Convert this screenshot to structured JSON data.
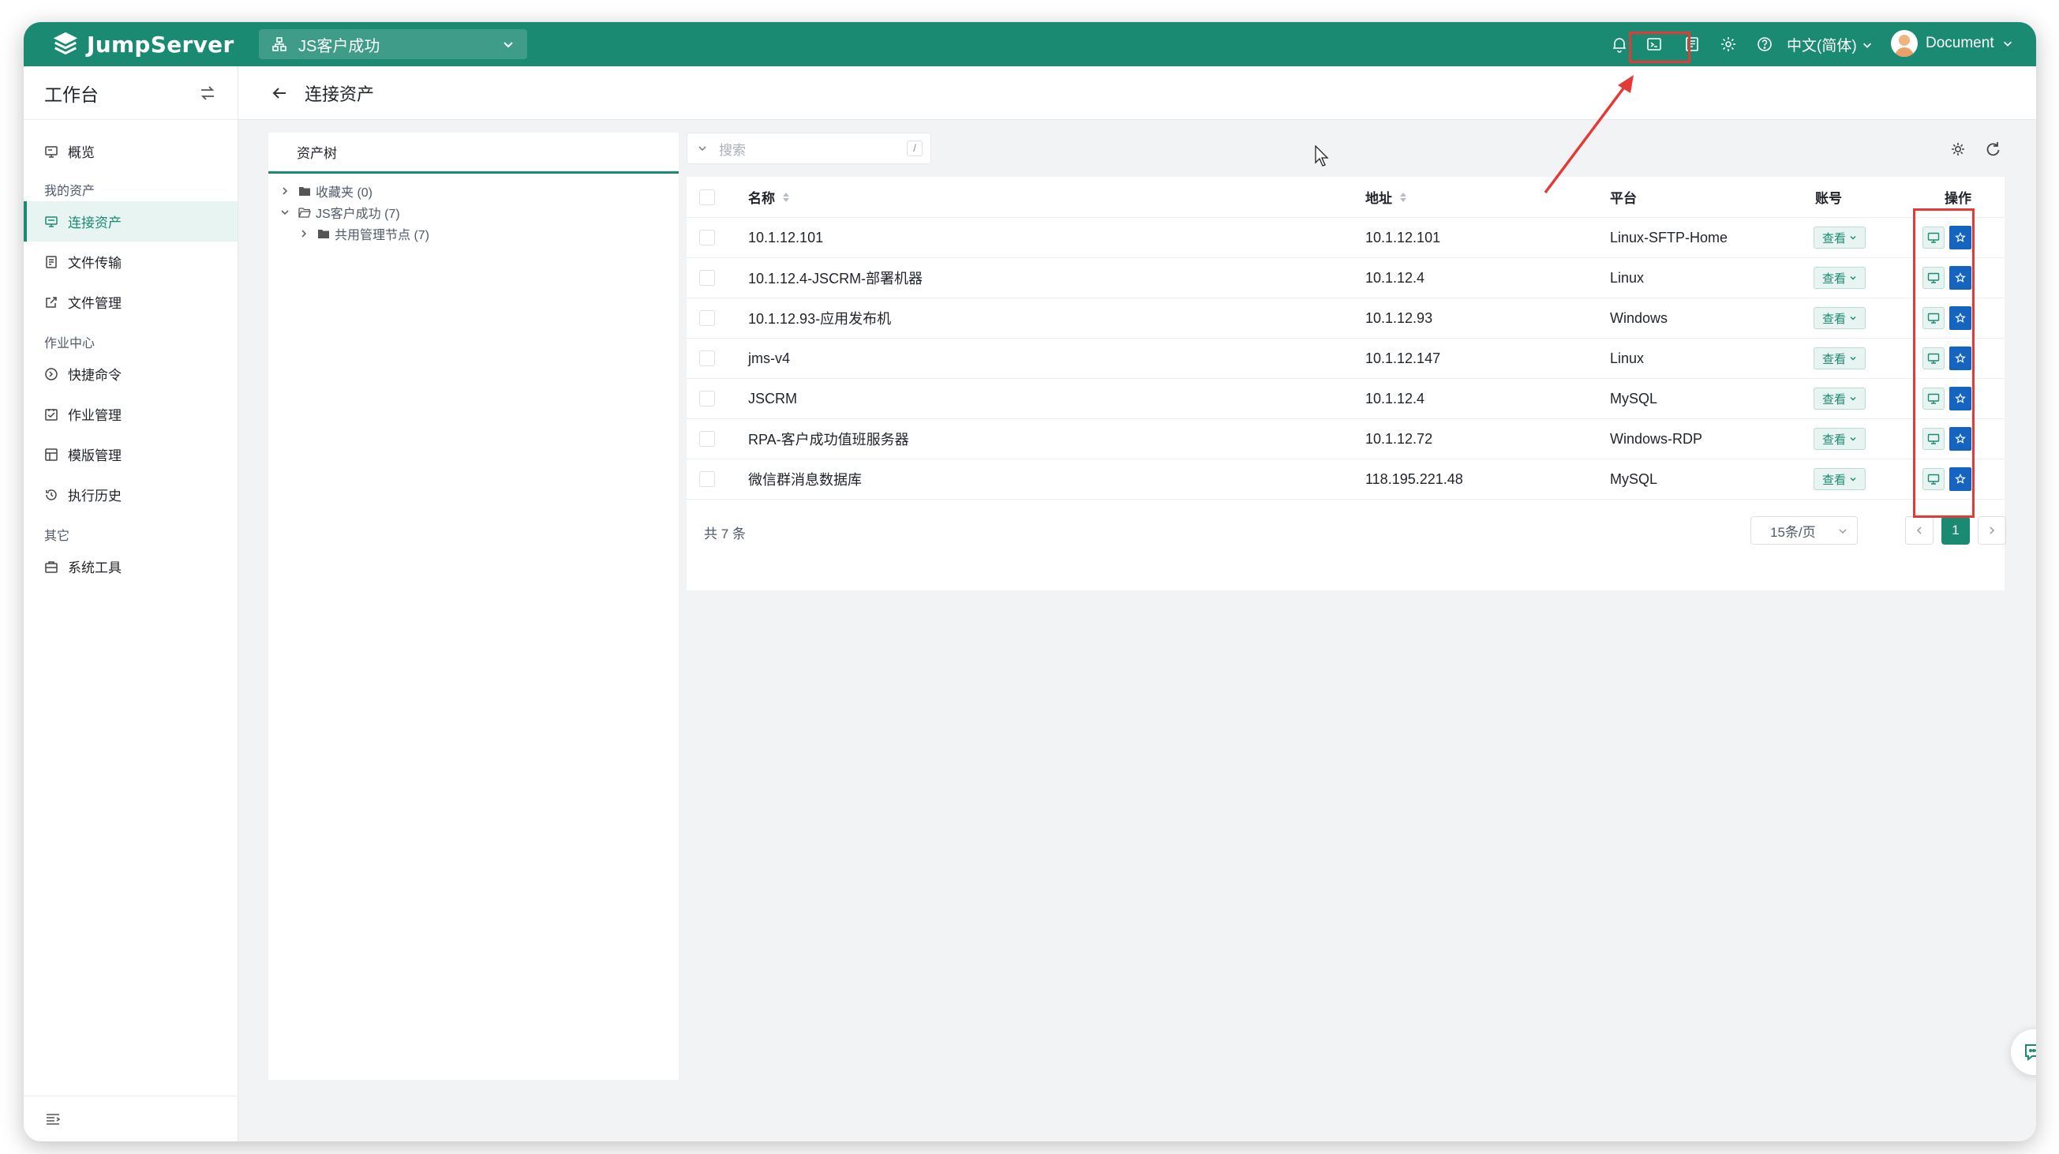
{
  "app": {
    "brand": "JumpServer",
    "org_select": "JS客户成功",
    "language": "中文(简体)",
    "user": "Document"
  },
  "sidebar": {
    "title": "工作台",
    "groups": [
      {
        "title": "",
        "items": [
          {
            "label": "概览",
            "icon": "monitor-icon"
          }
        ]
      },
      {
        "title": "我的资产",
        "items": [
          {
            "label": "连接资产",
            "icon": "desktop-icon",
            "active": true
          },
          {
            "label": "文件传输",
            "icon": "file-transfer-icon"
          },
          {
            "label": "文件管理",
            "icon": "external-link-icon"
          }
        ]
      },
      {
        "title": "作业中心",
        "items": [
          {
            "label": "快捷命令",
            "icon": "command-icon"
          },
          {
            "label": "作业管理",
            "icon": "job-icon"
          },
          {
            "label": "模版管理",
            "icon": "template-icon"
          },
          {
            "label": "执行历史",
            "icon": "history-icon"
          }
        ]
      },
      {
        "title": "其它",
        "items": [
          {
            "label": "系统工具",
            "icon": "toolbox-icon"
          }
        ]
      }
    ]
  },
  "page": {
    "title": "连接资产"
  },
  "tree": {
    "title": "资产树",
    "nodes": [
      {
        "label": "收藏夹 (0)",
        "level": 0,
        "expanded": false
      },
      {
        "label": "JS客户成功 (7)",
        "level": 0,
        "expanded": true
      },
      {
        "label": "共用管理节点 (7)",
        "level": 1,
        "expanded": false
      }
    ]
  },
  "search": {
    "placeholder": "搜索",
    "shortcut": "/"
  },
  "table": {
    "headers": {
      "name": "名称",
      "address": "地址",
      "platform": "平台",
      "account": "账号",
      "actions": "操作"
    },
    "view_label": "查看",
    "rows": [
      {
        "name": "10.1.12.101",
        "address": "10.1.12.101",
        "platform": "Linux-SFTP-Home"
      },
      {
        "name": "10.1.12.4-JSCRM-部署机器",
        "address": "10.1.12.4",
        "platform": "Linux"
      },
      {
        "name": "10.1.12.93-应用发布机",
        "address": "10.1.12.93",
        "platform": "Windows"
      },
      {
        "name": "jms-v4",
        "address": "10.1.12.147",
        "platform": "Linux"
      },
      {
        "name": "JSCRM",
        "address": "10.1.12.4",
        "platform": "MySQL"
      },
      {
        "name": "RPA-客户成功值班服务器",
        "address": "10.1.12.72",
        "platform": "Windows-RDP"
      },
      {
        "name": "微信群消息数据库",
        "address": "118.195.221.48",
        "platform": "MySQL"
      }
    ],
    "total": "共 7 条",
    "page_size": "15条/页",
    "current_page": "1"
  },
  "colors": {
    "brand": "#1a8a72",
    "annotation": "#e53935",
    "star_button": "#1565c0"
  }
}
